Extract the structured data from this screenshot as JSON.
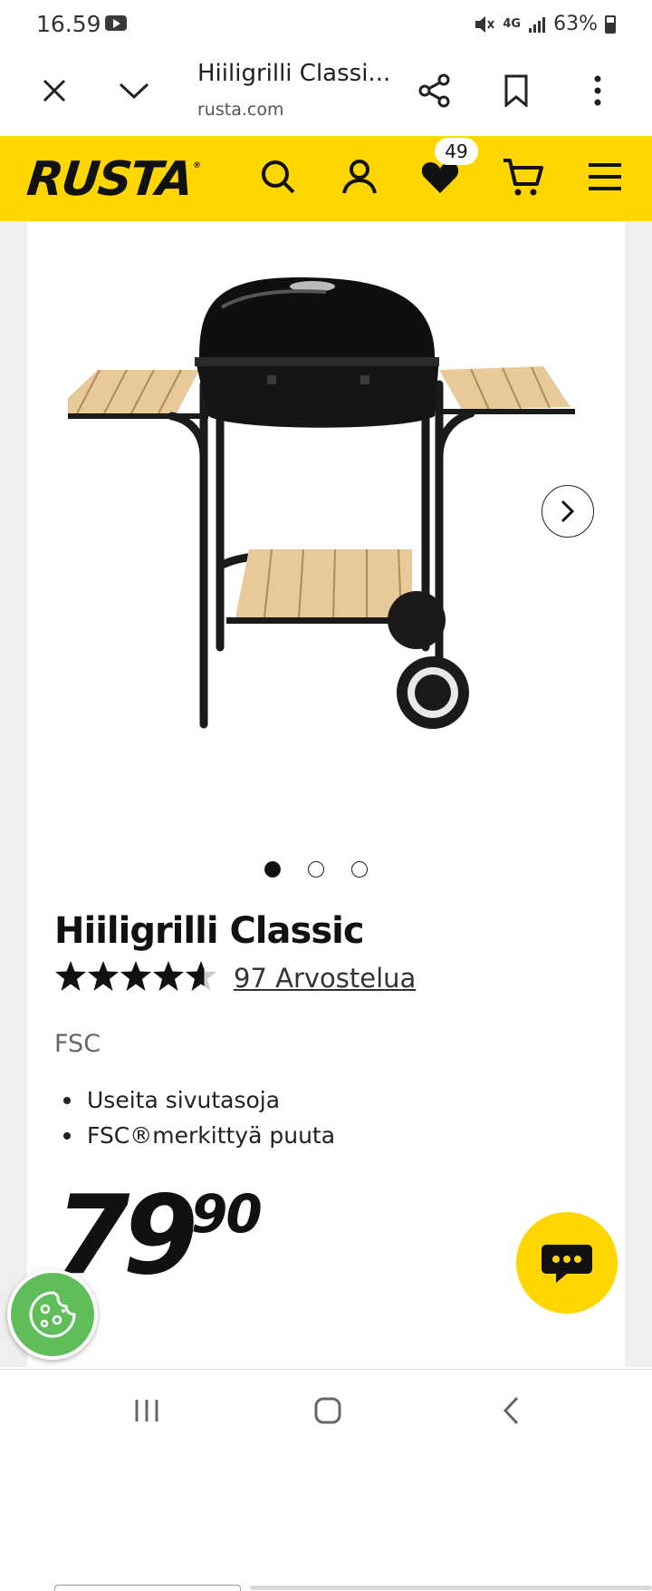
{
  "status_bar": {
    "time": "16.59",
    "network": "4G",
    "battery": "63%"
  },
  "browser": {
    "title": "Hiiligrilli Classi...",
    "url": "rusta.com"
  },
  "header": {
    "logo": "RUSTA",
    "logo_mark": "®",
    "wishlist_count": "49"
  },
  "product": {
    "name": "Hiiligrilli Classic",
    "rating": 4.6,
    "rating_max": 5,
    "reviews_label": "97 Arvostelua",
    "certification": "FSC",
    "features": [
      "Useita sivutasoja",
      "FSC®merkittyä puuta"
    ],
    "price_main": "79",
    "price_decimals": "90",
    "gallery_images": 3,
    "gallery_active": 1
  },
  "colors": {
    "brand_yellow": "#ffd600",
    "cookie_green": "#5fbe5a",
    "text_dark": "#111111"
  }
}
